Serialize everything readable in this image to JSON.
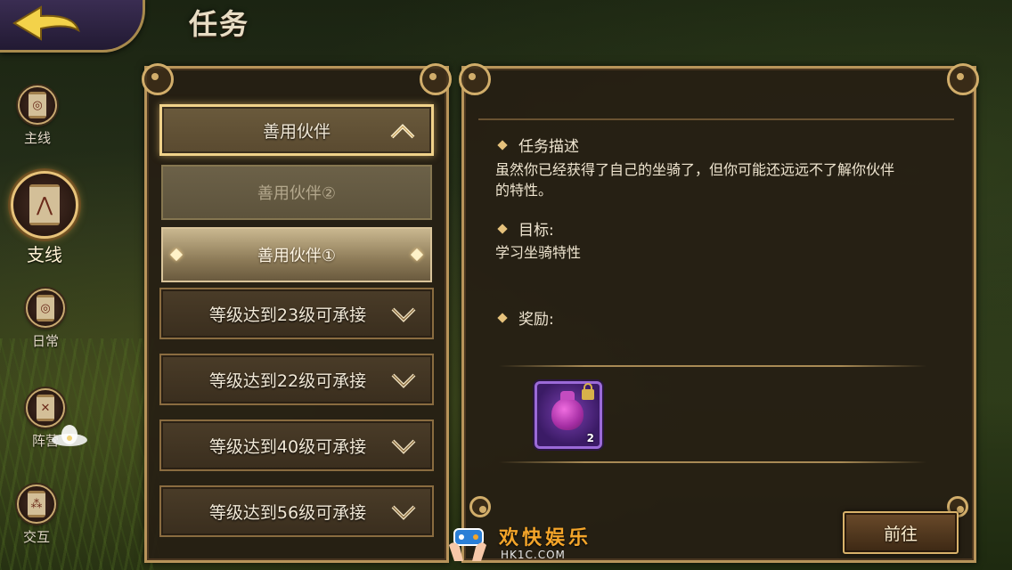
{
  "header": {
    "title": "任务"
  },
  "nav": [
    {
      "label": "主线",
      "glyph": "◎",
      "active": false
    },
    {
      "label": "支线",
      "glyph": "⋀",
      "active": true
    },
    {
      "label": "日常",
      "glyph": "◎",
      "active": false
    },
    {
      "label": "阵营",
      "glyph": "✕",
      "active": false
    },
    {
      "label": "交互",
      "glyph": "⁂",
      "active": false
    }
  ],
  "quest_list": {
    "group_title": "善用伙伴",
    "sub_items": [
      {
        "label": "善用伙伴②",
        "state": "disabled"
      },
      {
        "label": "善用伙伴①",
        "state": "current"
      }
    ],
    "locked_items": [
      "等级达到23级可承接",
      "等级达到22级可承接",
      "等级达到40级可承接",
      "等级达到56级可承接"
    ]
  },
  "detail": {
    "description_title": "任务描述",
    "description_line1": "虽然你已经获得了自己的坐骑了，但你可能还远远不了解你伙伴",
    "description_line2": "的特性。",
    "goal_title": "目标:",
    "goal_text": "学习坐骑特性",
    "reward_title": "奖励:",
    "reward": {
      "icon": "purple-bag-icon",
      "count": "2",
      "locked": true
    },
    "go_button": "前往"
  },
  "watermark": {
    "text": "欢快娱乐",
    "url": "HK1C.COM"
  },
  "colors": {
    "frame_gold": "#b8945a",
    "panel_bg": "#261e14",
    "accent_orange": "#f4a52a",
    "reward_purple": "#7a3fb0"
  }
}
